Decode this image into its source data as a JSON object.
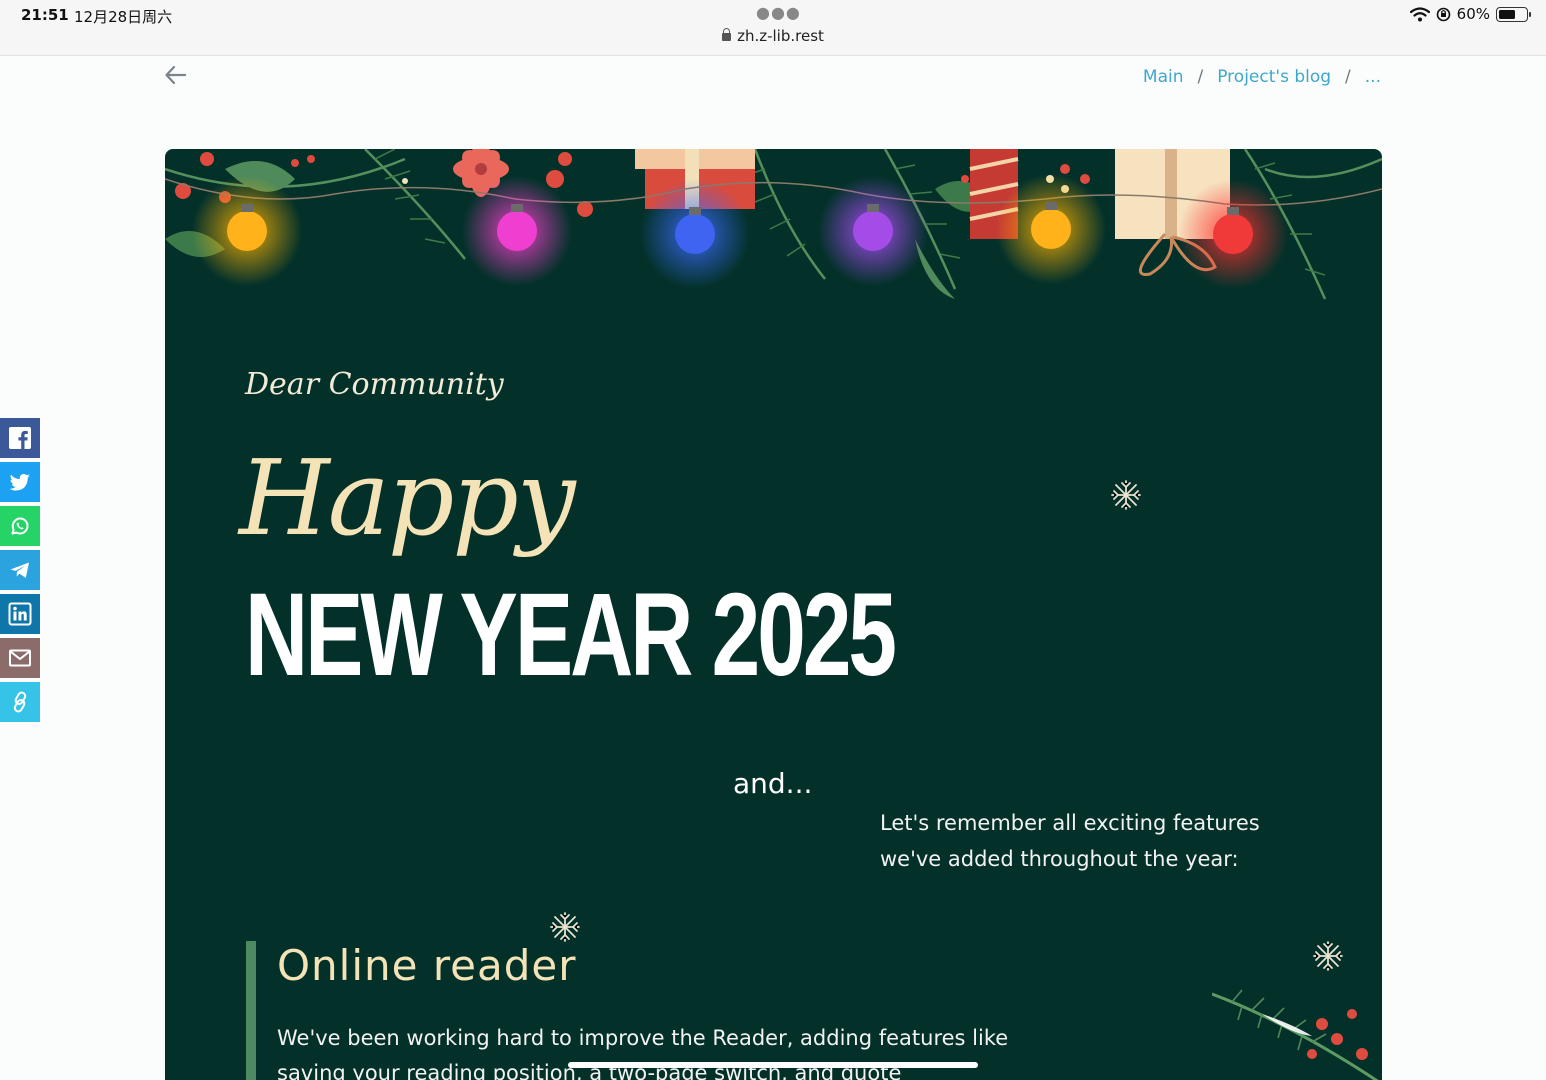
{
  "status_bar": {
    "time": "21:51",
    "date": "12月28日周六",
    "url": "zh.z-lib.rest",
    "battery": "60%",
    "battery_level": 0.6
  },
  "nav": {
    "breadcrumb": [
      "Main",
      "Project's blog",
      "..."
    ]
  },
  "share_buttons": [
    {
      "name": "facebook",
      "color": "#3b5998"
    },
    {
      "name": "twitter",
      "color": "#1da1f2"
    },
    {
      "name": "whatsapp",
      "color": "#25d366"
    },
    {
      "name": "telegram",
      "color": "#2aa3df"
    },
    {
      "name": "linkedin",
      "color": "#0e76a8"
    },
    {
      "name": "email",
      "color": "#8c6b6b"
    },
    {
      "name": "copy-link",
      "color": "#35c4e8"
    }
  ],
  "card": {
    "background": "#03312a",
    "greeting": "Dear Community",
    "happy": "Happy",
    "headline": "NEW YEAR 2025",
    "and": "and...",
    "intro": "Let's remember all exciting features we've added throughout the year:",
    "section": {
      "title": "Online reader",
      "text": "We've been working hard to improve the Reader, adding features like saving your reading position, a two-page switch, and quote"
    }
  }
}
